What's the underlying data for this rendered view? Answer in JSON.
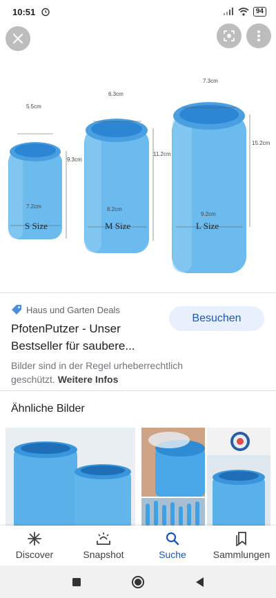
{
  "status_bar": {
    "time": "10:51",
    "battery": "94"
  },
  "image": {
    "sizes": [
      {
        "label": "S Size",
        "top_width": "5.5cm",
        "height": "9.3cm",
        "bottom_width": "7.2cm"
      },
      {
        "label": "M Size",
        "top_width": "6.3cm",
        "height": "11.2cm",
        "bottom_width": "8.2cm"
      },
      {
        "label": "L Size",
        "top_width": "7.3cm",
        "height": "15.2cm",
        "bottom_width": "9.2cm"
      }
    ]
  },
  "result": {
    "source": "Haus und Garten Deals",
    "title": "PfotenPutzer - Unser Bestseller für saubere...",
    "visit_label": "Besuchen",
    "copyright_text": "Bilder sind in der Regel urheberrechtlich geschützt.",
    "copyright_link": "Weitere Infos"
  },
  "similar": {
    "heading": "Ähnliche Bilder"
  },
  "bottom_nav": {
    "items": [
      {
        "label": "Discover",
        "icon": "asterisk-icon"
      },
      {
        "label": "Snapshot",
        "icon": "snapshot-icon"
      },
      {
        "label": "Suche",
        "icon": "search-icon",
        "active": true
      },
      {
        "label": "Sammlungen",
        "icon": "collections-icon"
      }
    ]
  },
  "colors": {
    "accent": "#1a56b8",
    "button_bg": "#e8f0fe",
    "product_blue": "#5fb4ea"
  }
}
